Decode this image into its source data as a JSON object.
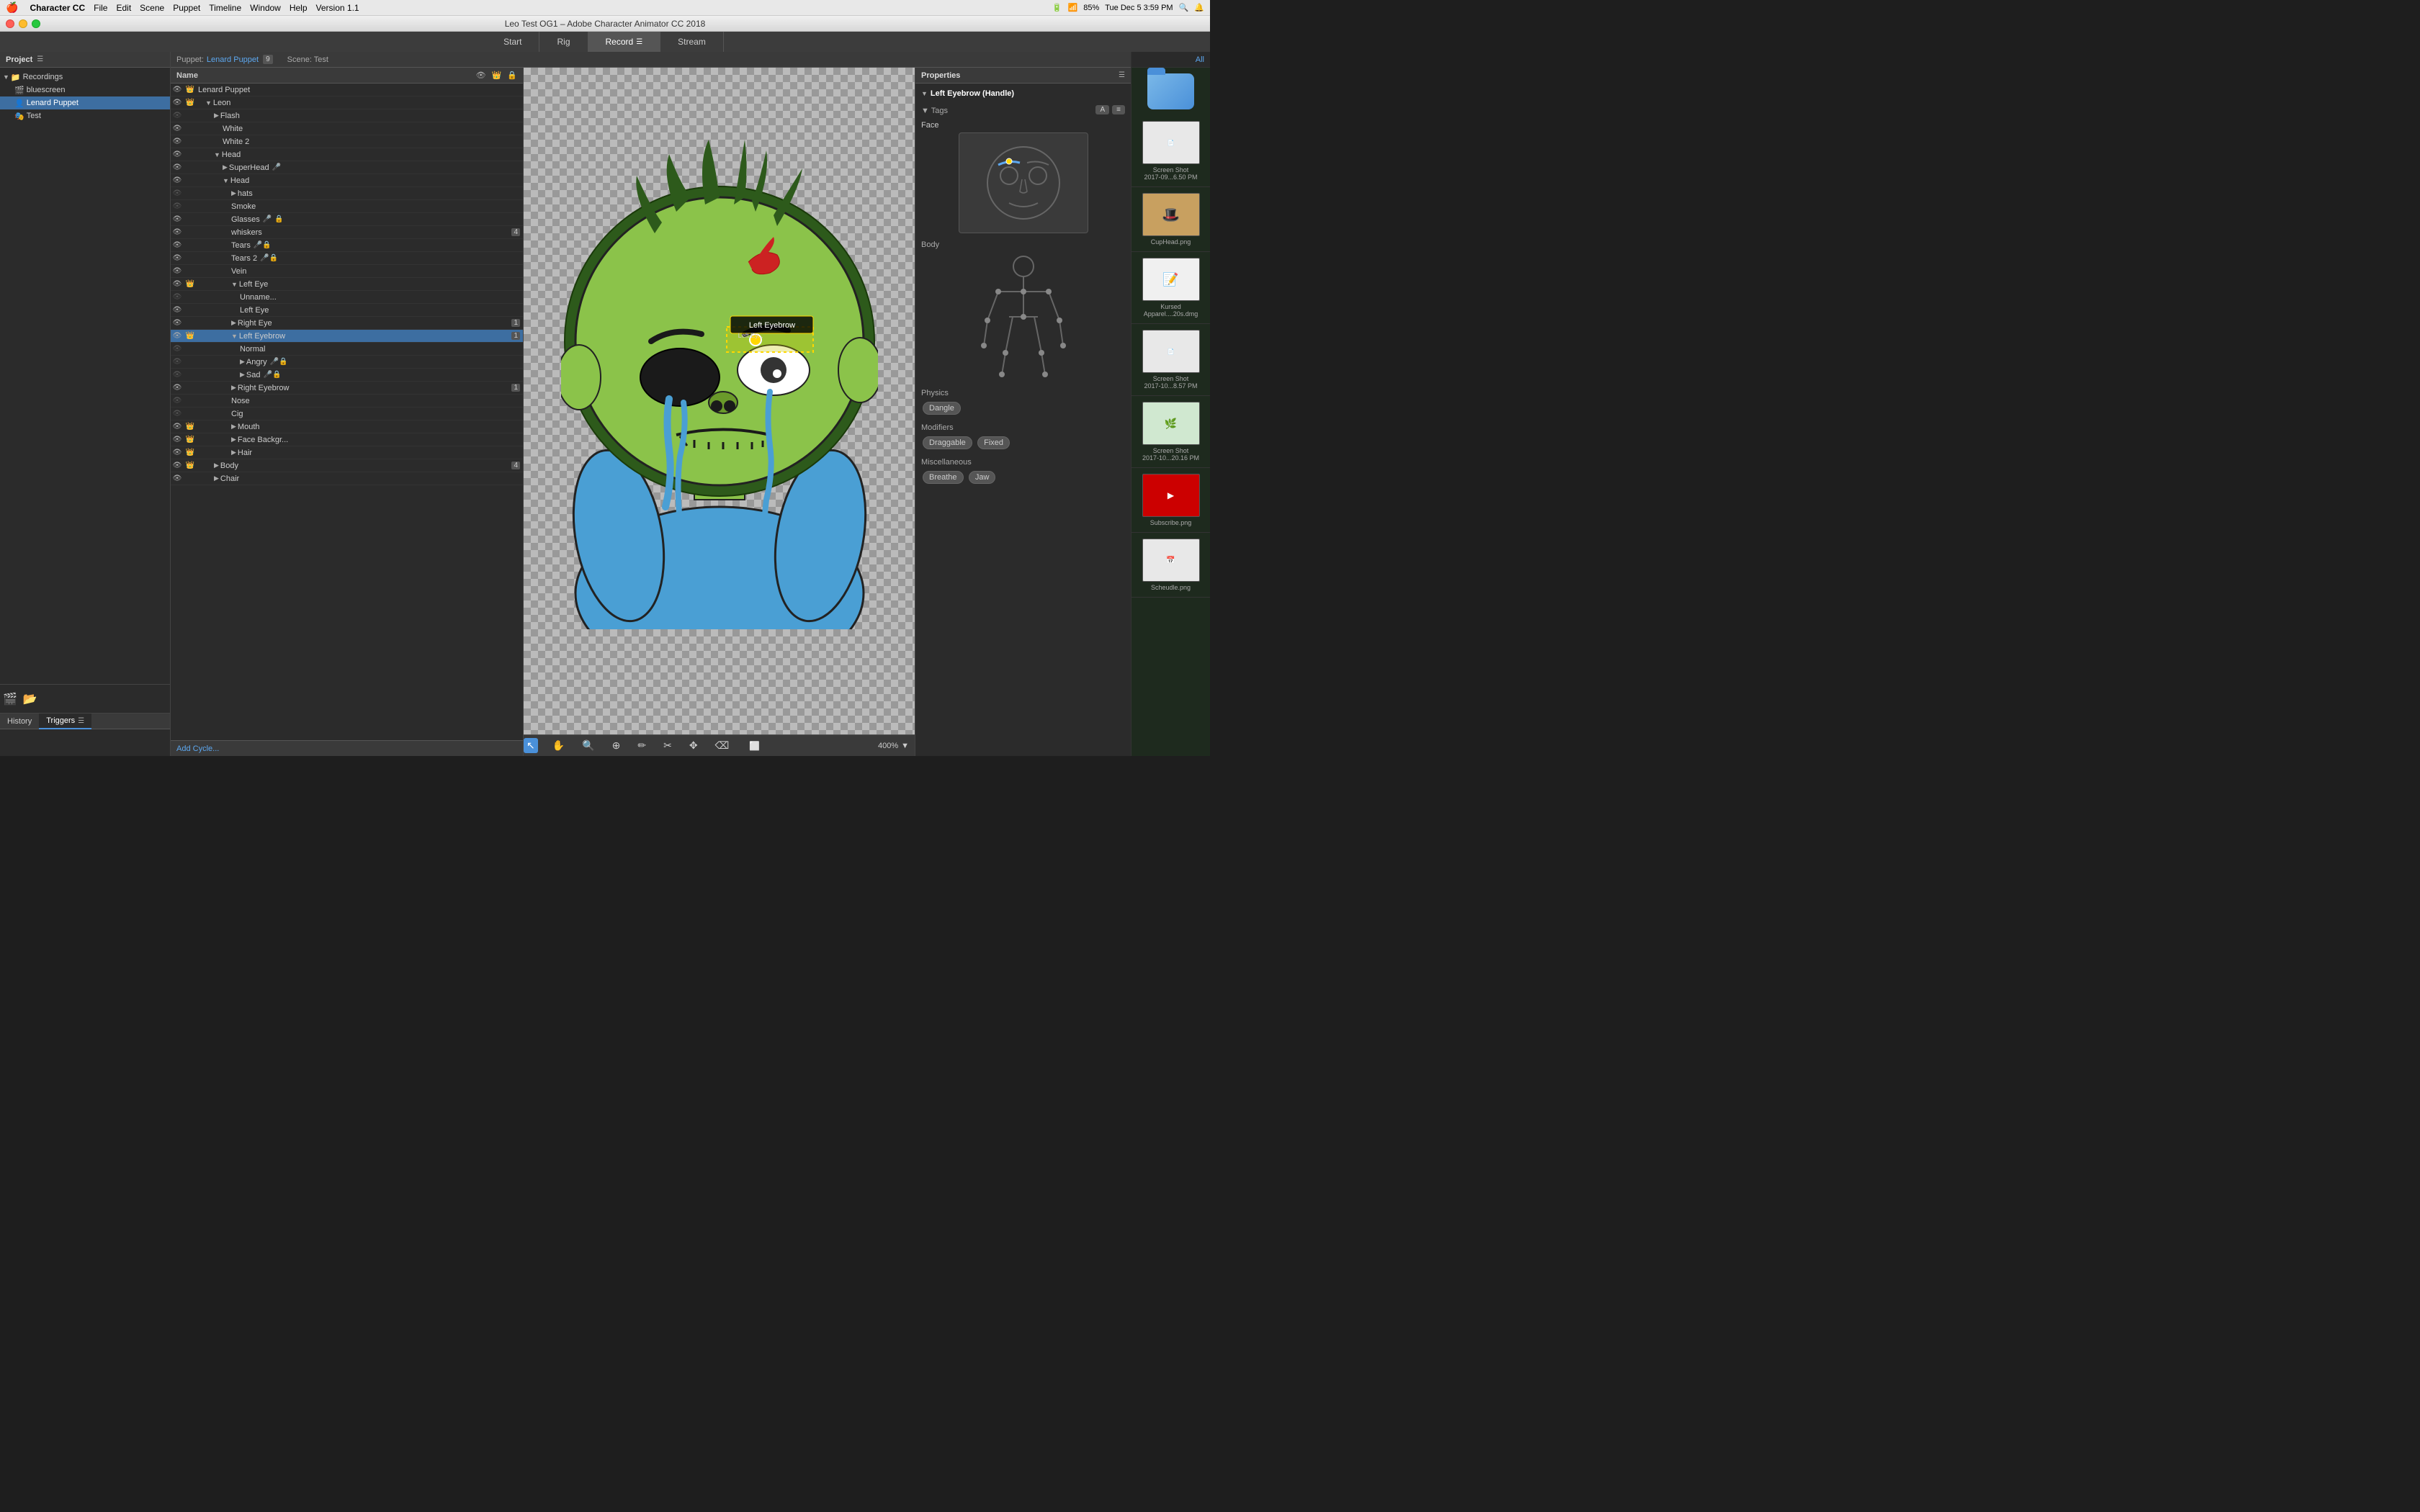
{
  "menubar": {
    "apple": "🍎",
    "app_name": "Character CC",
    "menus": [
      "File",
      "Edit",
      "Scene",
      "Puppet",
      "Timeline",
      "Window",
      "Help",
      "Version 1.1"
    ],
    "right": [
      "85%",
      "Tue Dec 5",
      "3:59 PM"
    ]
  },
  "window": {
    "title": "Leo Test OG1 – Adobe Character Animator CC 2018",
    "traffic_lights": [
      "close",
      "minimize",
      "maximize"
    ]
  },
  "app_tabs": [
    {
      "label": "Start",
      "active": false
    },
    {
      "label": "Rig",
      "active": false
    },
    {
      "label": "Record",
      "active": true,
      "has_icon": true
    },
    {
      "label": "Stream",
      "active": false
    }
  ],
  "puppet_panel": {
    "puppet_label": "Puppet:",
    "puppet_name": "Lenard Puppet",
    "icon_count": "9",
    "scene_label": "Scene: Test"
  },
  "layers": {
    "header": {
      "name_col": "Name"
    },
    "items": [
      {
        "name": "Lenard Puppet",
        "level": 0,
        "kind": "root",
        "has_arrow": false,
        "badge": "",
        "vis": true
      },
      {
        "name": "Leon",
        "level": 1,
        "kind": "crown",
        "has_arrow": true,
        "badge": "",
        "vis": true
      },
      {
        "name": "Flash",
        "level": 2,
        "kind": "",
        "has_arrow": true,
        "badge": "",
        "vis": false
      },
      {
        "name": "White",
        "level": 3,
        "kind": "",
        "has_arrow": false,
        "badge": "",
        "vis": true
      },
      {
        "name": "White 2",
        "level": 3,
        "kind": "",
        "has_arrow": false,
        "badge": "",
        "vis": true
      },
      {
        "name": "Head",
        "level": 2,
        "kind": "",
        "has_arrow": true,
        "badge": "",
        "vis": true
      },
      {
        "name": "SuperHead",
        "level": 3,
        "kind": "",
        "has_arrow": true,
        "badge": "",
        "vis": true,
        "mic": true
      },
      {
        "name": "Head",
        "level": 3,
        "kind": "",
        "has_arrow": true,
        "badge": "",
        "vis": true
      },
      {
        "name": "hats",
        "level": 4,
        "kind": "",
        "has_arrow": true,
        "badge": "",
        "vis": false
      },
      {
        "name": "Smoke",
        "level": 4,
        "kind": "",
        "has_arrow": false,
        "badge": "",
        "vis": false
      },
      {
        "name": "Glasses",
        "level": 4,
        "kind": "",
        "has_arrow": false,
        "badge": "",
        "vis": true,
        "mic": true
      },
      {
        "name": "whiskers",
        "level": 4,
        "kind": "",
        "has_arrow": false,
        "badge": "4",
        "vis": true
      },
      {
        "name": "Tears",
        "level": 4,
        "kind": "",
        "has_arrow": false,
        "badge": "",
        "vis": true,
        "has_icons": true
      },
      {
        "name": "Tears 2",
        "level": 4,
        "kind": "",
        "has_arrow": false,
        "badge": "",
        "vis": true,
        "has_icons": true
      },
      {
        "name": "Vein",
        "level": 4,
        "kind": "",
        "has_arrow": false,
        "badge": "",
        "vis": true
      },
      {
        "name": "Left Eye",
        "level": 4,
        "kind": "crown",
        "has_arrow": true,
        "badge": "",
        "vis": true
      },
      {
        "name": "Unname...",
        "level": 5,
        "kind": "",
        "has_arrow": false,
        "badge": "",
        "vis": false
      },
      {
        "name": "Left Eye",
        "level": 5,
        "kind": "",
        "has_arrow": false,
        "badge": "",
        "vis": true
      },
      {
        "name": "Right Eye",
        "level": 4,
        "kind": "",
        "has_arrow": true,
        "badge": "1",
        "vis": true
      },
      {
        "name": "Left Eyebrow",
        "level": 4,
        "kind": "crown",
        "has_arrow": true,
        "badge": "1",
        "vis": true,
        "selected": true
      },
      {
        "name": "Normal",
        "level": 5,
        "kind": "",
        "has_arrow": false,
        "badge": "",
        "vis": false
      },
      {
        "name": "Angry",
        "level": 5,
        "kind": "",
        "has_arrow": true,
        "badge": "",
        "vis": false,
        "mic": true
      },
      {
        "name": "Sad",
        "level": 5,
        "kind": "",
        "has_arrow": true,
        "badge": "",
        "vis": false,
        "mic": true
      },
      {
        "name": "Right Eyebrow",
        "level": 4,
        "kind": "",
        "has_arrow": true,
        "badge": "1",
        "vis": true
      },
      {
        "name": "Nose",
        "level": 4,
        "kind": "",
        "has_arrow": false,
        "badge": "",
        "vis": false
      },
      {
        "name": "Cig",
        "level": 4,
        "kind": "",
        "has_arrow": false,
        "badge": "",
        "vis": false
      },
      {
        "name": "Mouth",
        "level": 4,
        "kind": "crown",
        "has_arrow": true,
        "badge": "",
        "vis": true
      },
      {
        "name": "Face Backgr...",
        "level": 4,
        "kind": "crown",
        "has_arrow": true,
        "badge": "",
        "vis": true
      },
      {
        "name": "Hair",
        "level": 4,
        "kind": "crown",
        "has_arrow": true,
        "badge": "",
        "vis": true
      },
      {
        "name": "Body",
        "level": 2,
        "kind": "crown",
        "has_arrow": true,
        "badge": "4",
        "vis": true
      },
      {
        "name": "Chair",
        "level": 2,
        "kind": "",
        "has_arrow": true,
        "badge": "",
        "vis": true
      }
    ],
    "add_cycle": "Add Cycle..."
  },
  "properties": {
    "title": "Properties",
    "section_title": "Left Eyebrow (Handle)",
    "tags_label": "Tags",
    "face_label": "Face",
    "body_label": "Body",
    "physics_label": "Physics",
    "physics_chips": [
      "Dangle"
    ],
    "modifiers_label": "Modifiers",
    "modifiers_chips": [
      "Draggable",
      "Fixed"
    ],
    "misc_label": "Miscellaneous",
    "misc_chips": [
      "Breathe",
      "Jaw"
    ]
  },
  "canvas": {
    "zoom": "400%",
    "tools": [
      "cursor",
      "hand",
      "zoom-out",
      "target",
      "pen",
      "scissors",
      "move",
      "eraser"
    ]
  },
  "eyebrow_tooltip": "Left Eyebrow",
  "desktop": {
    "all_label": "All",
    "items": [
      {
        "label": "Screen Shot\n2017-09...6.50 PM",
        "type": "screenshot"
      },
      {
        "label": "CupHead.png",
        "type": "image"
      },
      {
        "label": "Kursed\nApparel....20s.dmg",
        "type": "file"
      },
      {
        "label": "Screen Shot\n2017-10...8.57 PM",
        "type": "screenshot"
      },
      {
        "label": "Screen Shot\n2017-10...20.16 PM",
        "type": "screenshot"
      },
      {
        "label": "Subscribe.png",
        "type": "image"
      },
      {
        "label": "Scheudle.png",
        "type": "screenshot"
      }
    ]
  },
  "project": {
    "panel_title": "Project",
    "tree": [
      {
        "name": "Recordings",
        "level": 0,
        "kind": "folder",
        "expanded": true
      },
      {
        "name": "bluescreen",
        "level": 1,
        "kind": "item"
      },
      {
        "name": "Lenard Puppet",
        "level": 1,
        "kind": "puppet",
        "selected": true
      },
      {
        "name": "Test",
        "level": 1,
        "kind": "scene"
      }
    ]
  },
  "bottom_tabs": [
    {
      "label": "History",
      "active": false
    },
    {
      "label": "Triggers",
      "active": true
    }
  ]
}
